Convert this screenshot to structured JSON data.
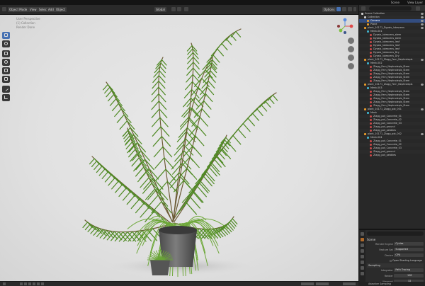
{
  "topbar": {
    "workspace": "Scene",
    "view_layer": "View Layer"
  },
  "viewport_header": {
    "mode": "Object Mode",
    "menus": [
      "View",
      "Select",
      "Add",
      "Object"
    ],
    "transform": "Global",
    "options": "Options"
  },
  "viewport_info": {
    "line1": "User Perspective",
    "line2": "(1) Collection",
    "line3": "Render Done"
  },
  "outliner": {
    "title": "Scene Collection",
    "rows": [
      {
        "label": "Scene Collection",
        "kind": "col",
        "indent": 0
      },
      {
        "label": "Collection",
        "kind": "col",
        "indent": 1
      },
      {
        "label": "Camera",
        "kind": "obj",
        "indent": 2,
        "selected": true
      },
      {
        "label": "Plane",
        "kind": "obj",
        "indent": 2
      },
      {
        "label": "plant_10171_Dypsis_lutescens",
        "kind": "obj",
        "indent": 1
      },
      {
        "label": "Mesh.001",
        "kind": "mesh",
        "indent": 2
      },
      {
        "label": "Dypsis_lutescens_stem",
        "kind": "mat",
        "indent": 3
      },
      {
        "label": "Dypsis_lutescens_stem",
        "kind": "mat",
        "indent": 3
      },
      {
        "label": "Dypsis_lutescens_leaf",
        "kind": "mat",
        "indent": 3
      },
      {
        "label": "Dypsis_lutescens_leaf",
        "kind": "mat",
        "indent": 3
      },
      {
        "label": "Dypsis_lutescens_leaf",
        "kind": "mat",
        "indent": 3
      },
      {
        "label": "Dypsis_lutescens_Dry",
        "kind": "mat",
        "indent": 3
      },
      {
        "label": "Dypsis_lutescens_Dry",
        "kind": "mat",
        "indent": 3
      },
      {
        "label": "plant_10171_Zlagg_Fern_Nephrolepis",
        "kind": "obj",
        "indent": 1
      },
      {
        "label": "Mesh.002",
        "kind": "mesh",
        "indent": 2
      },
      {
        "label": "Zlagg_Fern_Nephrolepis_Stem",
        "kind": "mat",
        "indent": 3
      },
      {
        "label": "Zlagg_Fern_Nephrolepis_Stem",
        "kind": "mat",
        "indent": 3
      },
      {
        "label": "Zlagg_Fern_Nephrolepis_Stem",
        "kind": "mat",
        "indent": 3
      },
      {
        "label": "Zlagg_Fern_Nephrolepis_Stem",
        "kind": "mat",
        "indent": 3
      },
      {
        "label": "Zlagg_Fern_Nephrolepis_Stem",
        "kind": "mat",
        "indent": 3
      },
      {
        "label": "plant_10171_Zlagg_Fern_Nephrolepis",
        "kind": "obj",
        "indent": 1
      },
      {
        "label": "Mesh.003",
        "kind": "mesh",
        "indent": 2
      },
      {
        "label": "Zlagg_Fern_Nephrolepis_Stem",
        "kind": "mat",
        "indent": 3
      },
      {
        "label": "Zlagg_Fern_Nephrolepis_Stem",
        "kind": "mat",
        "indent": 3
      },
      {
        "label": "Zlagg_Fern_Nephrolepis_Stem",
        "kind": "mat",
        "indent": 3
      },
      {
        "label": "Zlagg_Fern_Nephrolepis_Stem",
        "kind": "mat",
        "indent": 3
      },
      {
        "label": "Zlagg_Fern_Nephrolepis_Stem",
        "kind": "mat",
        "indent": 3
      },
      {
        "label": "plant_10171_Zlagg_pot_001",
        "kind": "obj",
        "indent": 1
      },
      {
        "label": "Mesh",
        "kind": "mesh",
        "indent": 2
      },
      {
        "label": "Zlagg_pot_Concrete_01",
        "kind": "mat",
        "indent": 3
      },
      {
        "label": "Zlagg_pot_Concrete_02",
        "kind": "mat",
        "indent": 3
      },
      {
        "label": "Zlagg_pot_Concrete_03",
        "kind": "mat",
        "indent": 3
      },
      {
        "label": "Zlagg_pot_ground",
        "kind": "mat",
        "indent": 3
      },
      {
        "label": "Zlagg_pot_pebbles",
        "kind": "mat",
        "indent": 3
      },
      {
        "label": "plant_10171_Zlagg_pot_002",
        "kind": "obj",
        "indent": 1
      },
      {
        "label": "Mesh.004",
        "kind": "mesh",
        "indent": 2
      },
      {
        "label": "Zlagg_pot_Concrete_01",
        "kind": "mat",
        "indent": 3
      },
      {
        "label": "Zlagg_pot_Concrete_02",
        "kind": "mat",
        "indent": 3
      },
      {
        "label": "Zlagg_pot_Concrete_03",
        "kind": "mat",
        "indent": 3
      },
      {
        "label": "Zlagg_pot_ground",
        "kind": "mat",
        "indent": 3
      },
      {
        "label": "Zlagg_pot_pebbles",
        "kind": "mat",
        "indent": 3
      }
    ]
  },
  "properties": {
    "scene_label": "Scene",
    "render_engine_label": "Render Engine",
    "render_engine": "Cycles",
    "feature_set_label": "Feature Set",
    "feature_set": "Supported",
    "device_label": "Device",
    "device": "CPU",
    "osl_label": "Open Shading Language",
    "sampling_label": "Sampling",
    "integrator_label": "Integrator",
    "integrator": "Path Tracing",
    "render_label": "Render",
    "render_samples": "128",
    "viewport_label": "Viewport",
    "viewport_samples": "32",
    "adaptive_label": "Adaptive Sampling"
  },
  "colors": {
    "accent": "#4772b3",
    "selection": "#334d80",
    "leaf": "#5e9a2e",
    "pot": "#6b6b6b"
  }
}
